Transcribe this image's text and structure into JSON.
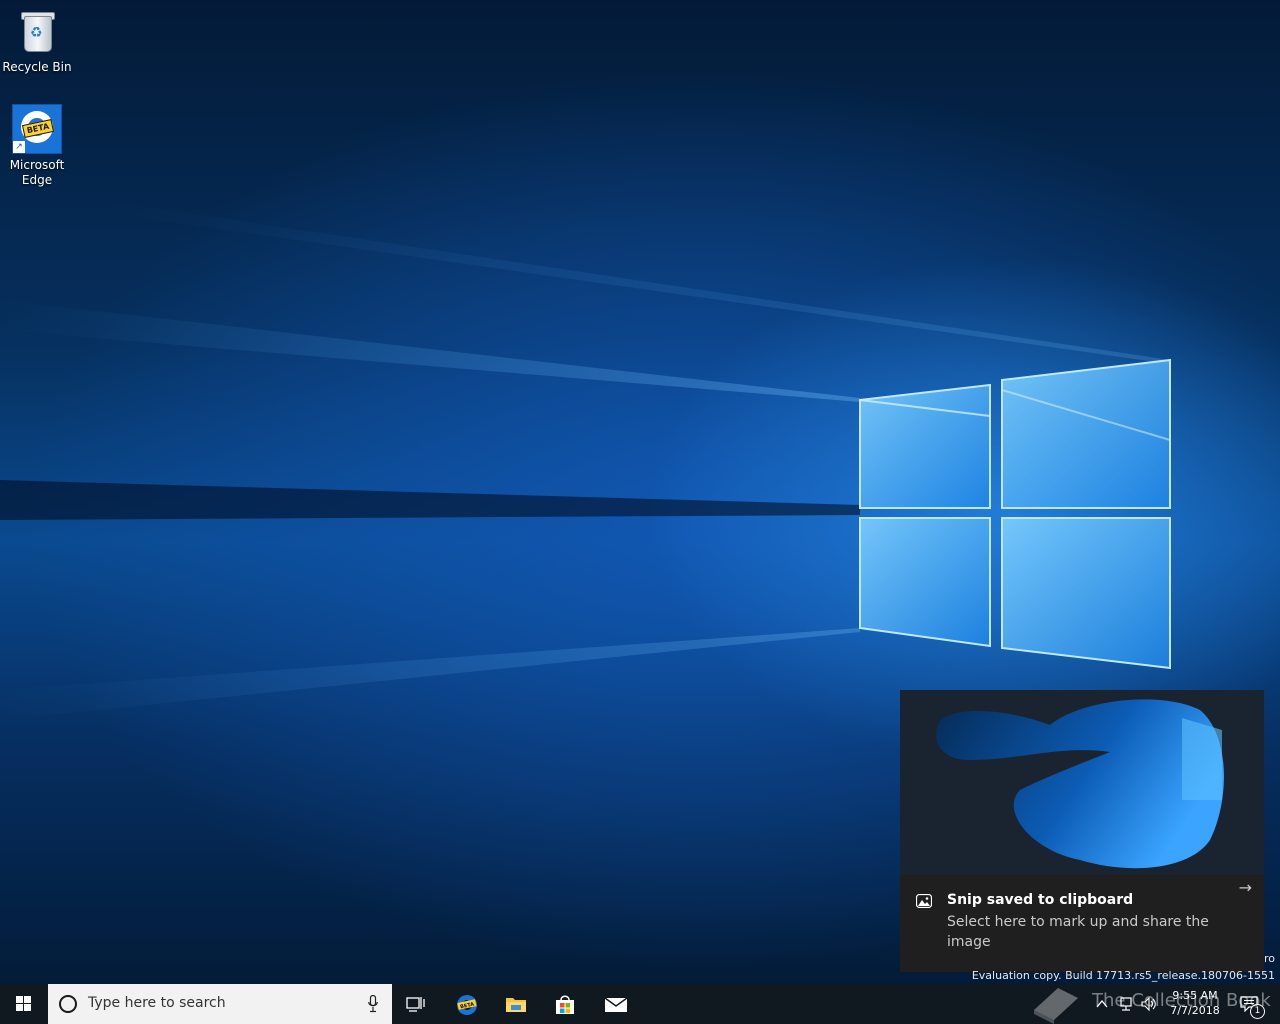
{
  "desktop": {
    "icons": [
      {
        "label": "Recycle Bin",
        "icon": "recycle-bin-icon"
      },
      {
        "label": "Microsoft Edge",
        "icon": "edge-beta-icon",
        "badge": "BETA"
      }
    ]
  },
  "toast": {
    "title": "Snip saved to clipboard",
    "body": "Select here to mark up and share the image",
    "arrow": "→",
    "icon": "snip-image-icon"
  },
  "watermark": {
    "edition": "ro",
    "build": "Evaluation copy. Build 17713.rs5_release.180706-1551"
  },
  "taskbar": {
    "search_placeholder": "Type here to search",
    "pinned": [
      "task-view-icon",
      "edge-beta-icon",
      "file-explorer-icon",
      "store-icon",
      "mail-icon"
    ],
    "clock": {
      "time": "9:55 AM",
      "date": "7/7/2018"
    },
    "notification_count": "1"
  },
  "overlay": {
    "text": "The Collection Book"
  },
  "colors": {
    "taskbar_bg": "#101820",
    "toast_bg": "#1f1f1f",
    "accent": "#1a73d6"
  }
}
